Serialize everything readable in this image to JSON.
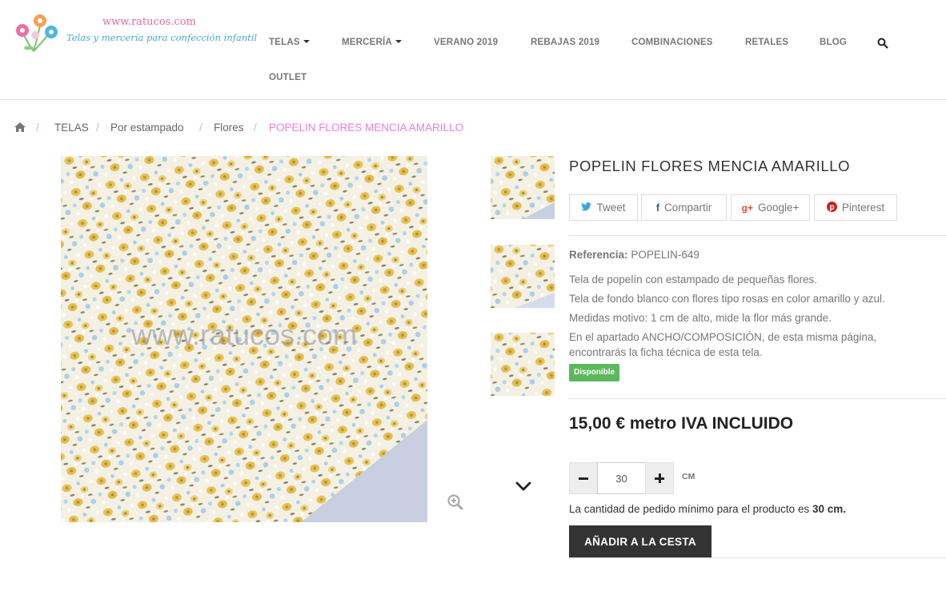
{
  "site": {
    "url_text": "www.ratucos.com",
    "tagline": "Telas y mercería para confección infantil"
  },
  "nav": {
    "items": [
      "TELAS",
      "MERCERÍA",
      "VERANO 2019",
      "REBAJAS 2019",
      "COMBINACIONES",
      "RETALES",
      "BLOG",
      "OUTLET"
    ],
    "search_icon": "search-icon"
  },
  "breadcrumb": {
    "home_icon": "home-icon",
    "separator": "/",
    "items": [
      "TELAS",
      "Por estampado",
      "Flores"
    ],
    "current": "POPELIN FLORES MENCIA AMARILLO"
  },
  "gallery": {
    "watermark": "www.ratucos.com",
    "zoom_icon": "zoom-in-icon",
    "scroll_icon": "chevron-down-icon"
  },
  "product": {
    "title": "POPELIN FLORES MENCIA AMARILLO",
    "share": [
      {
        "icon": "twitter-icon",
        "label": "Tweet"
      },
      {
        "icon": "facebook-icon",
        "label": "Compartir"
      },
      {
        "icon": "google-plus-icon",
        "label": "Google+"
      },
      {
        "icon": "pinterest-icon",
        "label": "Pinterest"
      }
    ],
    "reference_label": "Referencia:",
    "reference_value": "POPELIN-649",
    "description": [
      "Tela de popelín con estampado de pequeñas flores.",
      "Tela de fondo blanco con flores tipo rosas en color amarillo y azul.",
      "Medidas motivo: 1 cm de alto, mide la flor más grande.",
      "En el apartado ANCHO/COMPOSICIÓN, de esta misma página,",
      "encontrarás la ficha técnica de esta tela."
    ],
    "availability": "Disponible",
    "price": "15,00 € metro IVA INCLUIDO",
    "quantity": {
      "value": "30",
      "unit": "CM",
      "minus_icon": "minus-icon",
      "plus_icon": "plus-icon"
    },
    "min_qty_text": "La cantidad de pedido mínimo para el producto es",
    "min_qty_value": "30 cm.",
    "add_to_cart": "AÑADIR A LA CESTA"
  },
  "colors": {
    "breadcrumb_current": "#ea7fd6",
    "breadcrumb_separator": "#8ad1ee",
    "available_badge": "#5cb85c",
    "cart_button": "#333333"
  }
}
